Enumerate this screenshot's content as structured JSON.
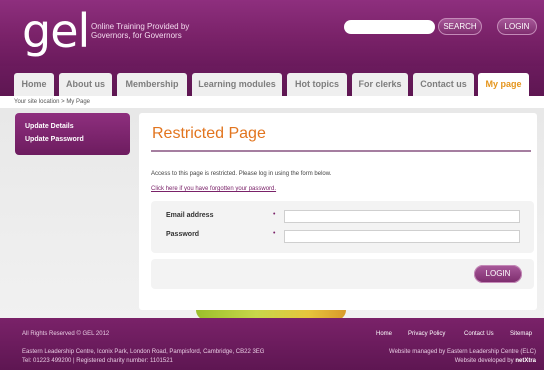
{
  "header": {
    "logo": "gel",
    "tagline_line1": "Online Training Provided by",
    "tagline_line2": "Governors, for Governors",
    "search_placeholder": "",
    "search_label": "SEARCH",
    "login_label": "LOGIN",
    "brand_color": "#7a2269"
  },
  "nav": {
    "tabs": [
      {
        "label": "Home"
      },
      {
        "label": "About us"
      },
      {
        "label": "Membership"
      },
      {
        "label": "Learning modules"
      },
      {
        "label": "Hot topics"
      },
      {
        "label": "For clerks"
      },
      {
        "label": "Contact us"
      },
      {
        "label": "My page"
      }
    ],
    "active_tab": "My page",
    "active_color": "#e5951c"
  },
  "breadcrumb": "Your site location > My Page",
  "sidebar": {
    "items": [
      {
        "label": "Update Details"
      },
      {
        "label": "Update Password"
      }
    ]
  },
  "main": {
    "title": "Restricted Page",
    "title_color": "#e2751f",
    "notice": "Access to this page is restricted. Please log in using the form below.",
    "forgot_link": "Click here if you have forgotten your password.",
    "form": {
      "email_label": "Email address",
      "password_label": "Password",
      "required_marker": "•",
      "email_value": "",
      "password_value": ""
    },
    "login_button": "LOGIN"
  },
  "footer": {
    "copyright": "All Rights Reserved © GEL 2012",
    "links": [
      {
        "label": "Home"
      },
      {
        "label": "Privacy Policy"
      },
      {
        "label": "Contact Us"
      },
      {
        "label": "Sitemap"
      }
    ],
    "address": "Eastern Leadership Centre, Iconix Park, London Road, Pampisford, Cambridge, CB22 3EG",
    "contact": "Tel: 01223 499200 | Registered charity number: 1101521",
    "managed_by": "Website managed by Eastern Leadership Centre (ELC)",
    "developed_by": "Website developed by",
    "developer": "netXtra"
  }
}
